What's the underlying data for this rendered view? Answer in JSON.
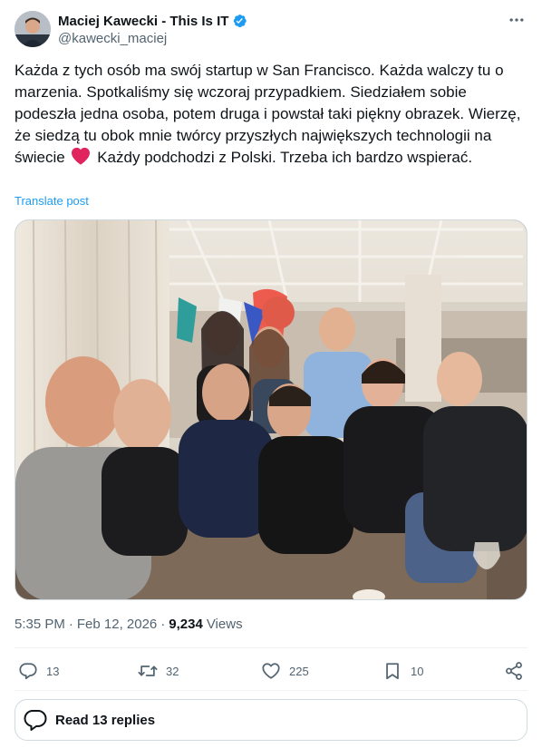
{
  "author": {
    "display_name": "Maciej Kawecki - This Is IT",
    "handle": "@kawecki_maciej",
    "verified": true
  },
  "post": {
    "text_part1": "Każda z tych osób ma swój startup w San Francisco. Każda walczy tu o marzenia. Spotkaliśmy się wczoraj przypadkiem. Siedziałem sobie podeszła jedna osoba, potem druga i powstał taki piękny obrazek. Wierzę, że siedzą tu obok mnie twórcy przyszłych największych technologii na świecie",
    "text_part2": "Każdy podchodzi z Polski. Trzeba ich bardzo wspierać.",
    "emoji": "red-heart",
    "translate_label": "Translate post"
  },
  "meta": {
    "time": "5:35 PM",
    "date": "Feb 12, 2026",
    "views_count": "9,234",
    "views_label": "Views"
  },
  "actions": {
    "replies": "13",
    "reposts": "32",
    "likes": "225",
    "bookmarks": "10"
  },
  "read_replies_label": "Read 13 replies",
  "colors": {
    "accent": "#1d9bf0",
    "text_primary": "#0f1419",
    "text_secondary": "#536471",
    "heart": "#f91880",
    "border": "#cfd9de"
  },
  "icons": [
    "verified-badge-icon",
    "more-icon",
    "reply-icon",
    "repost-icon",
    "like-icon",
    "bookmark-icon",
    "share-icon",
    "conversation-icon"
  ]
}
